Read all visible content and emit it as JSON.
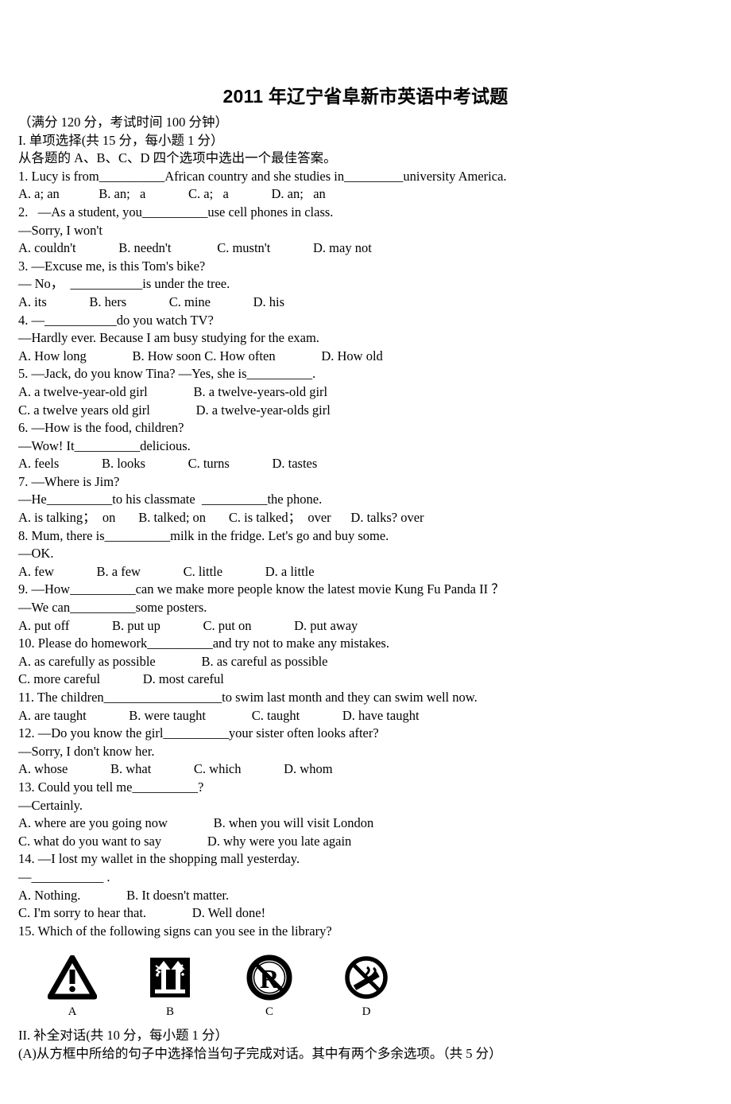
{
  "document": {
    "title": "2011 年辽宁省阜新市英语中考试题",
    "header_info": "（满分 120 分，考试时间 100 分钟）",
    "section_i_heading": "I. 单项选择(共 15 分，每小题 1 分）",
    "section_i_instruction": "从各题的 A、B、C、D 四个选项中选出一个最佳答案。",
    "section_ii_heading": "II. 补全对话(共 10 分，每小题 1 分）",
    "section_ii_instruction": "(A)从方框中所给的句子中选择恰当句子完成对话。其中有两个多余选项。（共 5 分）"
  },
  "lines": [
    "1. Lucy is from__________African country and she studies in_________university America.",
    "A. a; an            B. an;   a             C. a;   a             D. an;   an",
    "2.   —As a student, you__________use cell phones in class.",
    "—Sorry, I won't",
    "A. couldn't             B. needn't              C. mustn't             D. may not",
    "3. —Excuse me, is this Tom's bike?",
    "— No，  ___________is under the tree.",
    "A. its             B. hers             C. mine             D. his",
    "4. —___________do you watch TV?",
    "—Hardly ever. Because I am busy studying for the exam.",
    "A. How long              B. How soon C. How often              D. How old",
    "5. —Jack, do you know Tina? —Yes, she is__________.",
    "A. a twelve-year-old girl              B. a twelve-years-old girl",
    "C. a twelve years old girl              D. a twelve-year-olds girl",
    "6. —How is the food, children?",
    "—Wow! It__________delicious.",
    "A. feels             B. looks             C. turns             D. tastes",
    "7. —Where is Jim?",
    "—He__________to his classmate  __________the phone.",
    "A. is talking；  on       B. talked; on       C. is talked；  over      D. talks? over",
    "8. Mum, there is__________milk in the fridge. Let's go and buy some.",
    "—OK.",
    "A. few             B. a few             C. little             D. a little",
    "9. —How__________can we make more people know the latest movie Kung Fu Panda II ？",
    "—We can__________some posters.",
    "A. put off             B. put up             C. put on             D. put away",
    "10. Please do homework__________and try not to make any mistakes.",
    "A. as carefully as possible              B. as careful as possible",
    "C. more careful             D. most careful",
    "11. The children__________________to swim last month and they can swim well now.",
    "A. are taught             B. were taught              C. taught             D. have taught",
    "12. —Do you know the girl__________your sister often looks after?",
    "—Sorry, I don't know her.",
    "A. whose             B. what             C. which             D. whom",
    "13. Could you tell me__________?",
    "—Certainly.",
    "A. where are you going now              B. when you will visit London",
    "C. what do you want to say              D. why were you late again",
    "14. —I lost my wallet in the shopping mall yesterday.",
    "—___________ .",
    "A. Nothing.              B. It doesn't matter.",
    "C. I'm sorry to hear that.              D. Well done!",
    "15. Which of the following signs can you see in the library?"
  ],
  "signs": [
    {
      "label": "A",
      "icon": "warning-triangle-icon"
    },
    {
      "label": "B",
      "icon": "keep-dry-arrows-icon"
    },
    {
      "label": "C",
      "icon": "no-parking-circle-r-icon"
    },
    {
      "label": "D",
      "icon": "no-smoking-icon"
    }
  ],
  "colors": {
    "ink": "#000000",
    "paper": "#ffffff"
  }
}
